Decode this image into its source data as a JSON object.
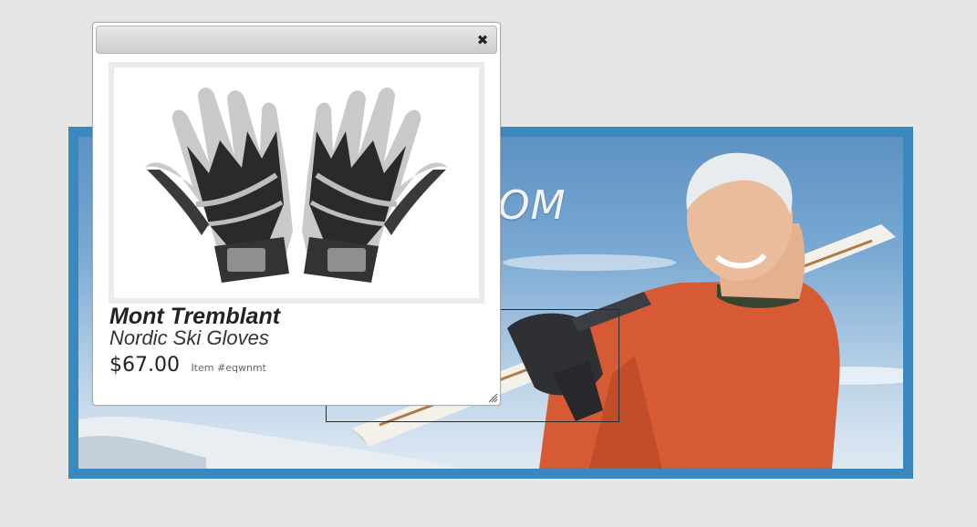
{
  "banner": {
    "headline": "OM"
  },
  "dialog": {
    "close_symbol": "✖",
    "close_icon": "close-icon",
    "resize_icon": "resize-grip-icon",
    "product": {
      "brand": "Mont Tremblant",
      "name": "Nordic Ski Gloves",
      "price": "$67.00",
      "item_label": "Item #eqwnmt",
      "image": "ski-gloves-product-image"
    }
  },
  "colors": {
    "page_background": "#e6e6e6",
    "banner_border": "#3a88bd",
    "dialog_background": "#ffffff",
    "titlebar": "#d9d9d9",
    "image_frame": "#ebebeb"
  }
}
